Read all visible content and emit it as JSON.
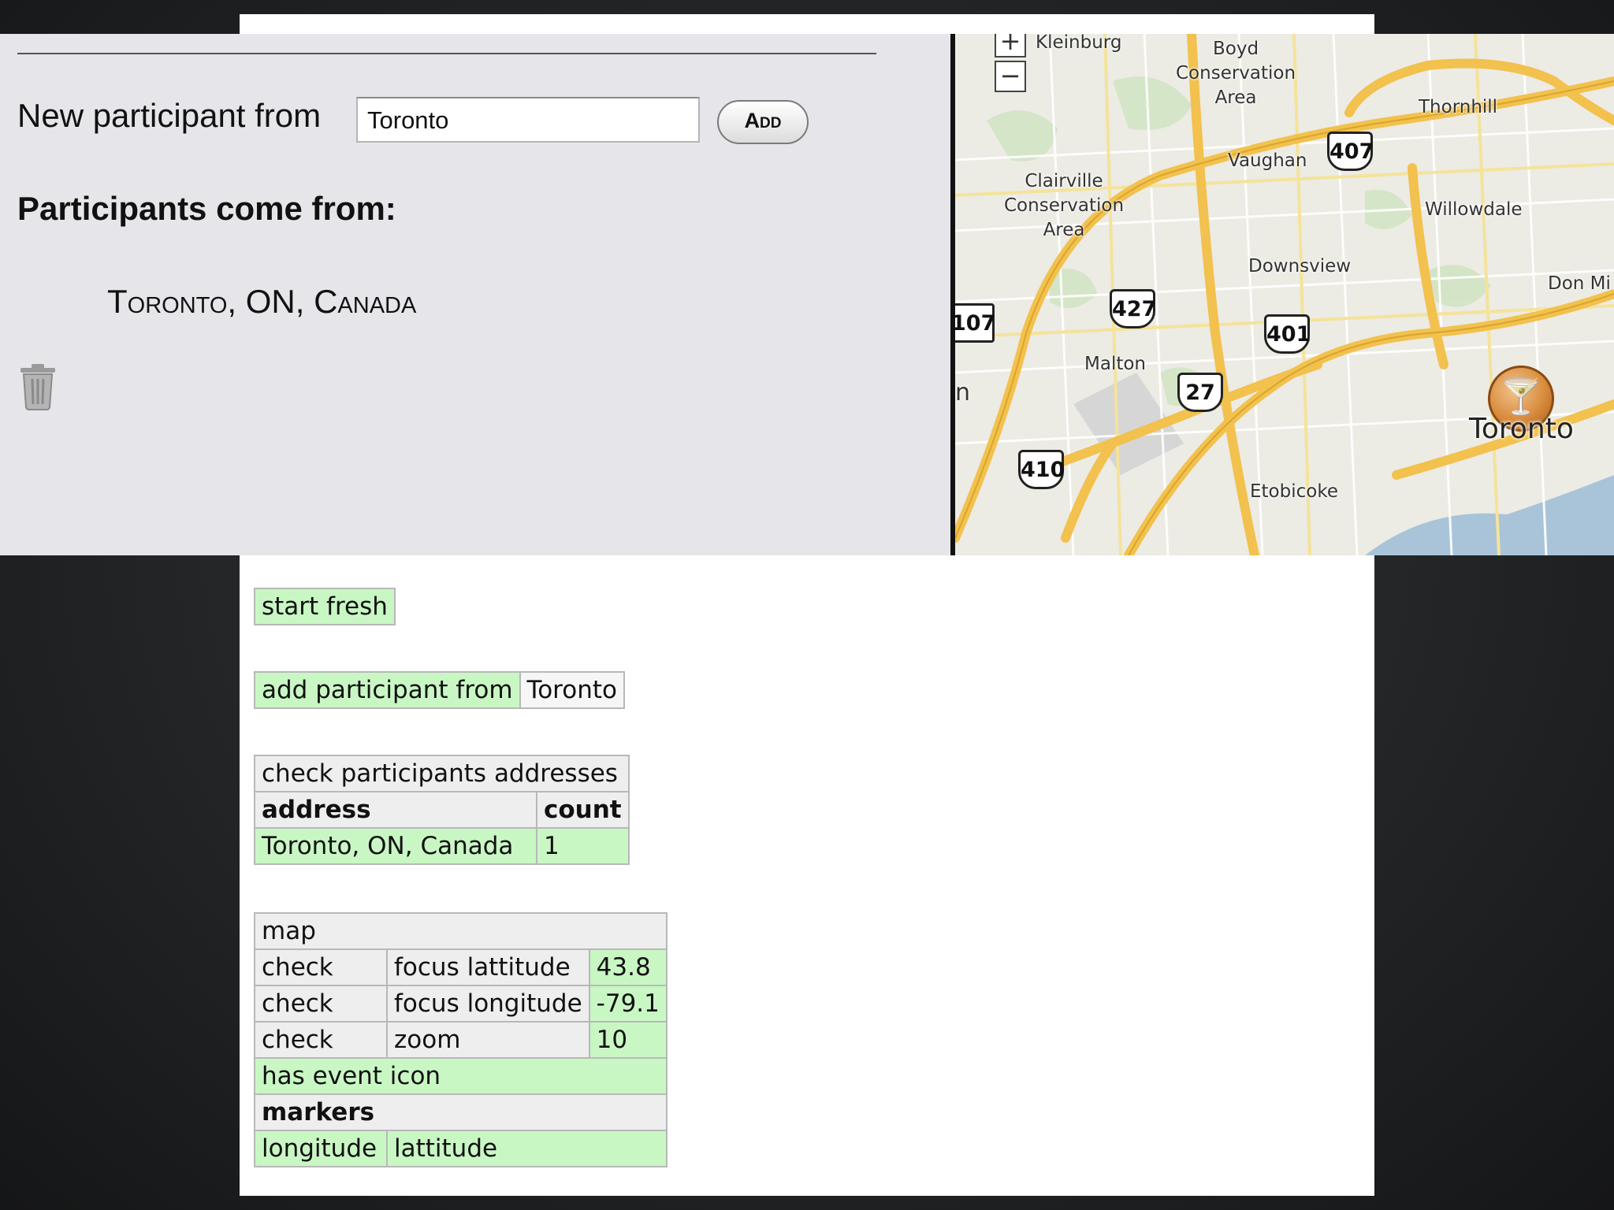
{
  "app": {
    "new_participant_label": "New participant from",
    "new_participant_value": "Toronto",
    "add_button": "Add",
    "participants_heading": "Participants come from:",
    "participants": [
      "Toronto, ON, Canada"
    ]
  },
  "map": {
    "zoom_in": "+",
    "zoom_out": "−",
    "labels": {
      "kleinburg": "Kleinburg",
      "boyd": "Boyd\nConservation\nArea",
      "thornhill": "Thornhill",
      "vaughan": "Vaughan",
      "clairville": "Clairville\nConservation\nArea",
      "willowdale": "Willowdale",
      "downsview": "Downsview",
      "don_mills": "Don Mi",
      "malton": "Malton",
      "etobicoke": "Etobicoke",
      "edge_n": "n"
    },
    "shields": {
      "s407": "407",
      "s427": "427",
      "s401": "401",
      "s27": "27",
      "s410": "410",
      "s107": "107"
    },
    "marker_label": "Toronto",
    "marker_icon": "martini-glass-icon"
  },
  "fit": {
    "start_fresh": "start fresh",
    "add_participant": {
      "action": "add participant from",
      "arg": "Toronto"
    },
    "check_addresses": {
      "title": "check participants addresses",
      "headers": [
        "address",
        "count"
      ],
      "row": [
        "Toronto, ON, Canada",
        "1"
      ]
    },
    "map_table": {
      "title": "map",
      "rows": [
        [
          "check",
          "focus lattitude",
          "43.8"
        ],
        [
          "check",
          "focus longitude",
          "-79.1"
        ],
        [
          "check",
          "zoom",
          "10"
        ]
      ],
      "has_event_icon": "has event icon",
      "markers": "markers",
      "marker_headers": [
        "longitude",
        "lattitude"
      ]
    }
  },
  "colors": {
    "pass": "#c9f7c4",
    "road": "#f2c14e",
    "water": "#a9c4d8"
  }
}
